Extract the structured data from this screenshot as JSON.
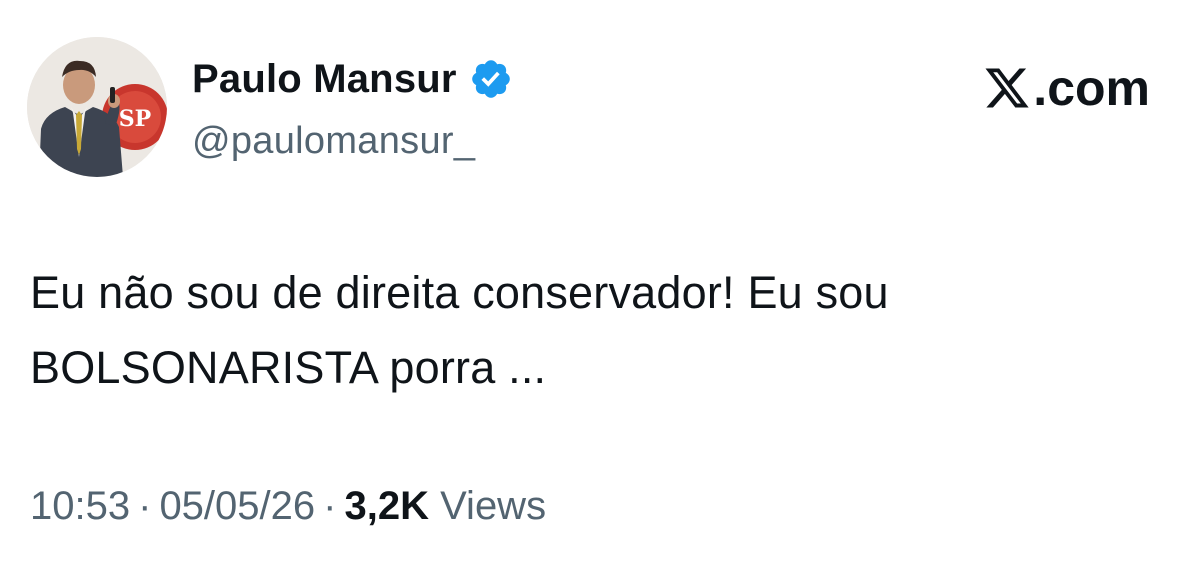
{
  "author": {
    "display_name": "Paulo Mansur",
    "handle": "@paulomansur_",
    "verified_icon": "verified-badge-icon",
    "avatar_sign_text": "SP"
  },
  "brand": {
    "icon": "x-logo-icon",
    "suffix": ".com"
  },
  "tweet": {
    "line1": "Eu não sou de direita conservador! Eu sou",
    "line2": "BOLSONARISTA porra ..."
  },
  "meta": {
    "time": "10:53",
    "separator": "·",
    "date": "05/05/26",
    "views_count": "3,2K",
    "views_label": "Views"
  },
  "colors": {
    "text": "#0f1419",
    "secondary": "#536471",
    "verified_blue": "#1d9bf0"
  }
}
